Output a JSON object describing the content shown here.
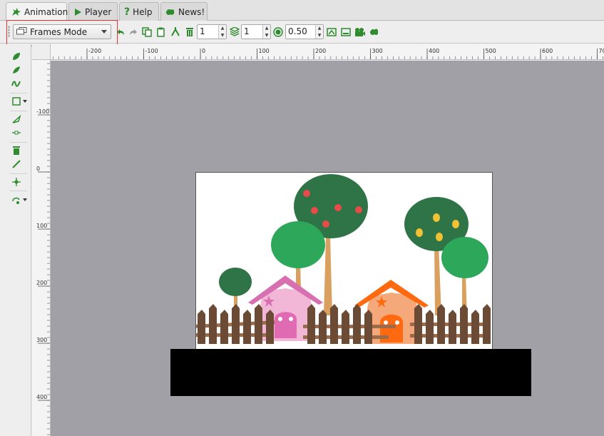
{
  "tabs": [
    {
      "label": "Animation",
      "icon": "animation-icon",
      "active": true
    },
    {
      "label": "Player",
      "icon": "play-icon",
      "active": false
    },
    {
      "label": "Help",
      "icon": "help-icon",
      "active": false
    },
    {
      "label": "News!",
      "icon": "news-icon",
      "active": false
    }
  ],
  "toolbar": {
    "mode_value": "Frames Mode",
    "layer_value": "1",
    "frame_value": "1",
    "opacity_value": "0.50",
    "icons": [
      "undo-icon",
      "redo-icon",
      "copy-frame-icon",
      "paste-frame-icon",
      "clone-icon",
      "delete-icon",
      "onion-skin-icon",
      "opacity-icon",
      "export-icon",
      "preview-icon",
      "camera-icon",
      "settings-icon"
    ]
  },
  "tools": [
    "pencil-icon",
    "ink-icon",
    "brush-icon",
    "rectangle-icon",
    "fill-icon",
    "pen-icon",
    "eraser-icon",
    "line-icon",
    "node-icon",
    "transform-icon"
  ],
  "rulers": {
    "h_labels": [
      "-200",
      "-100",
      "0",
      "100",
      "200",
      "300",
      "400",
      "500",
      "600",
      "70"
    ],
    "v_labels": [
      "-100",
      "0",
      "100",
      "200",
      "300",
      "400"
    ]
  },
  "colors": {
    "accent_green": "#2e8b2e",
    "highlight_red": "#e53030",
    "workspace_bg": "#a0a0a6"
  }
}
